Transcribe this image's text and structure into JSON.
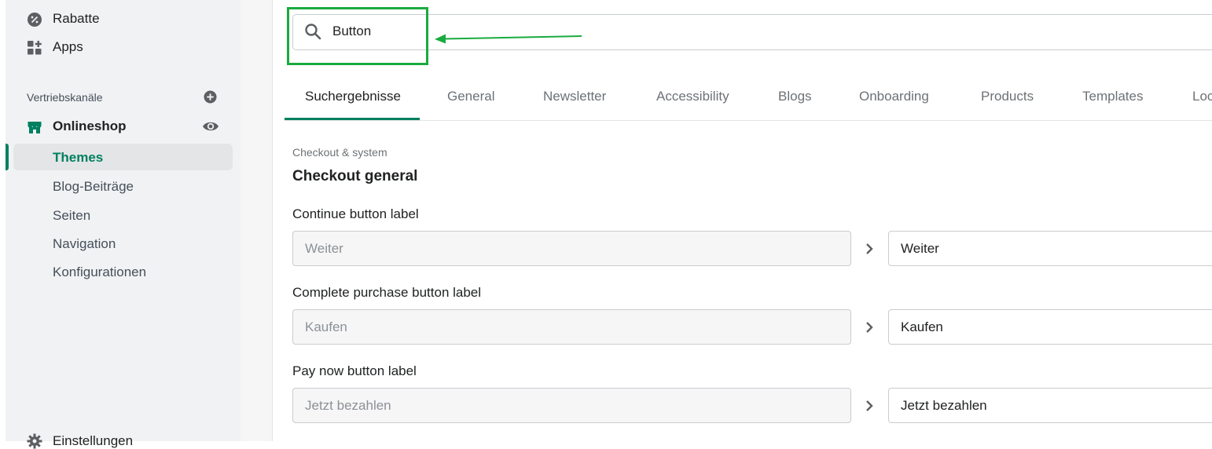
{
  "sidebar": {
    "rabatte_label": "Rabatte",
    "apps_label": "Apps",
    "section_label": "Vertriebskanäle",
    "onlineshop_label": "Onlineshop",
    "themes_label": "Themes",
    "sub_items": [
      "Blog-Beiträge",
      "Seiten",
      "Navigation",
      "Konfigurationen"
    ],
    "settings_label": "Einstellungen"
  },
  "search": {
    "value": "Button"
  },
  "tabs": [
    "Suchergebnisse",
    "General",
    "Newsletter",
    "Accessibility",
    "Blogs",
    "Onboarding",
    "Products",
    "Templates",
    "Loc"
  ],
  "content": {
    "breadcrumb": "Checkout & system",
    "title": "Checkout general",
    "fields": [
      {
        "label": "Continue button label",
        "default": "Weiter",
        "value": "Weiter"
      },
      {
        "label": "Complete purchase button label",
        "default": "Kaufen",
        "value": "Kaufen"
      },
      {
        "label": "Pay now button label",
        "default": "Jetzt bezahlen",
        "value": "Jetzt bezahlen"
      }
    ]
  },
  "colors": {
    "accent": "#008060",
    "highlight": "#1aab3f"
  }
}
